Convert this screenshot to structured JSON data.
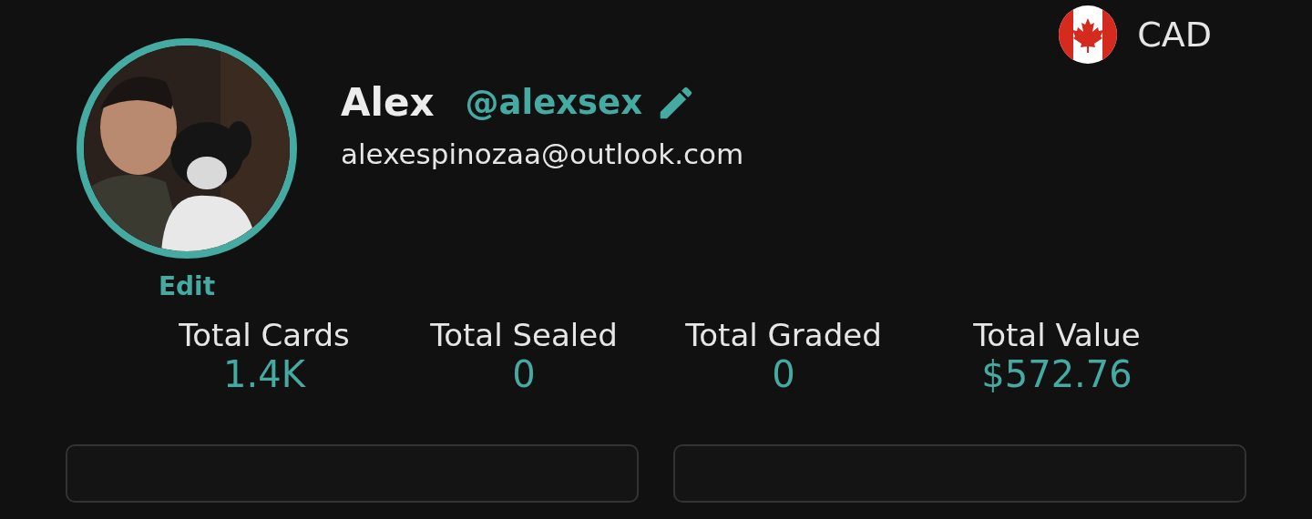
{
  "currency": {
    "code": "CAD"
  },
  "profile": {
    "name": "Alex",
    "handle": "@alexsex",
    "email": "alexespinozaa@outlook.com",
    "edit_label": "Edit"
  },
  "stats": [
    {
      "label": "Total Cards",
      "value": "1.4K"
    },
    {
      "label": "Total Sealed",
      "value": "0"
    },
    {
      "label": "Total Graded",
      "value": "0"
    },
    {
      "label": "Total Value",
      "value": "$572.76"
    }
  ],
  "cards": [
    {
      "kind": "panel"
    },
    {
      "kind": "panel"
    }
  ]
}
